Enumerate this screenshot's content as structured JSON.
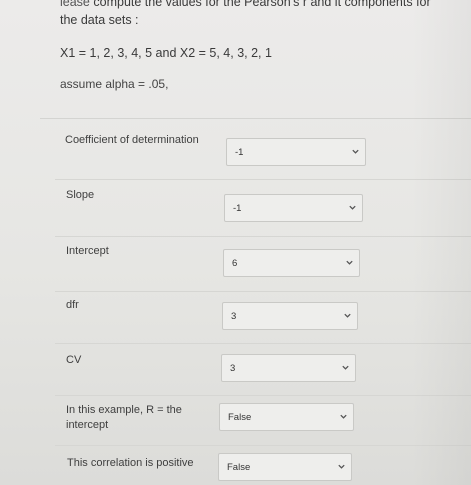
{
  "question": {
    "line1_visible": "compute the values for the Pearson's r and it components for",
    "line1_cut": "lease",
    "line2": "the data sets :",
    "data_sets": "X1 = 1, 2, 3, 4, 5 and X2 = 5, 4, 3, 2, 1",
    "alpha": "assume alpha = .05,"
  },
  "items": [
    {
      "label": "Coefficient of determination",
      "value": "-1"
    },
    {
      "label": "Slope",
      "value": "-1"
    },
    {
      "label": "Intercept",
      "value": "6"
    },
    {
      "label": "dfr",
      "value": "3"
    },
    {
      "label": "CV",
      "value": "3"
    },
    {
      "label": "In this example, R = the intercept",
      "value": "False"
    },
    {
      "label": "This correlation is positive",
      "value": "False"
    }
  ],
  "icons": {
    "dropdown": "chevron-down-icon"
  },
  "colors": {
    "background": "#e9e9e6",
    "select_bg": "#eeeeec",
    "border": "#c9c9c6",
    "text": "#3a3a3a"
  }
}
